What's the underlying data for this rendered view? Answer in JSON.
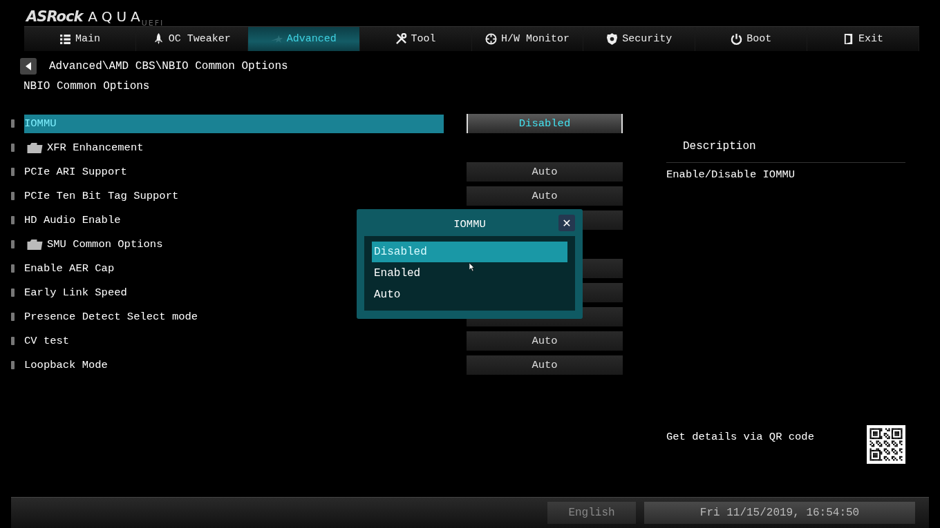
{
  "logo": {
    "brand": "ASRock",
    "product": "AQUA",
    "suffix": "UEFI"
  },
  "tabs": [
    {
      "label": "Main",
      "selected": false
    },
    {
      "label": "OC Tweaker",
      "selected": false
    },
    {
      "label": "Advanced",
      "selected": true
    },
    {
      "label": "Tool",
      "selected": false
    },
    {
      "label": "H/W Monitor",
      "selected": false
    },
    {
      "label": "Security",
      "selected": false
    },
    {
      "label": "Boot",
      "selected": false
    },
    {
      "label": "Exit",
      "selected": false
    }
  ],
  "breadcrumb": "Advanced\\AMD CBS\\NBIO Common Options",
  "page_title": "NBIO Common Options",
  "settings": [
    {
      "kind": "option",
      "label": "IOMMU",
      "value": "Disabled",
      "selected": true
    },
    {
      "kind": "folder",
      "label": "XFR Enhancement",
      "selected": false
    },
    {
      "kind": "option",
      "label": "PCIe ARI Support",
      "value": "Auto",
      "selected": false
    },
    {
      "kind": "option",
      "label": "PCIe Ten Bit Tag Support",
      "value": "Auto",
      "selected": false
    },
    {
      "kind": "option",
      "label": "HD Audio Enable",
      "selected": false
    },
    {
      "kind": "folder",
      "label": "SMU Common Options",
      "selected": false
    },
    {
      "kind": "option",
      "label": "Enable AER Cap",
      "selected": false
    },
    {
      "kind": "option",
      "label": "Early Link Speed",
      "selected": false
    },
    {
      "kind": "option",
      "label": "Presence Detect Select mode",
      "selected": false
    },
    {
      "kind": "option",
      "label": "CV test",
      "value": "Auto",
      "selected": false
    },
    {
      "kind": "option",
      "label": "Loopback Mode",
      "value": "Auto",
      "selected": false
    }
  ],
  "description": {
    "heading": "Description",
    "text": "Enable/Disable IOMMU",
    "qr_hint": "Get details via QR code"
  },
  "dialog": {
    "title": "IOMMU",
    "close": "✕",
    "options": [
      {
        "label": "Disabled",
        "selected": true
      },
      {
        "label": "Enabled",
        "selected": false
      },
      {
        "label": "Auto",
        "selected": false
      }
    ]
  },
  "status_bar": {
    "language": "English",
    "datetime": "Fri 11/15/2019, 16:54:50"
  }
}
